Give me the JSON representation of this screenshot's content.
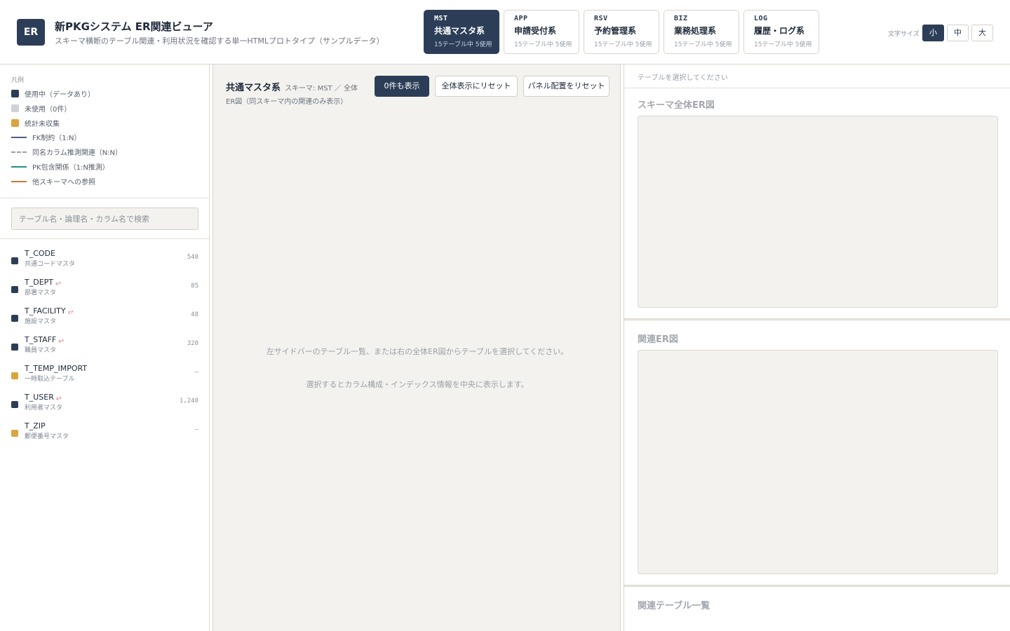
{
  "header": {
    "logo": "ER",
    "title": "新PKGシステム ER関連ビューア",
    "subtitle": "スキーマ横断のテーブル関連・利用状況を確認する単一HTMLプロトタイプ（サンプルデータ）",
    "tabs": [
      {
        "code": "MST",
        "name": "共通マスタ系",
        "count": "15テーブル中 5使用",
        "active": true
      },
      {
        "code": "APP",
        "name": "申請受付系",
        "count": "15テーブル中 5使用",
        "active": false
      },
      {
        "code": "RSV",
        "name": "予約管理系",
        "count": "15テーブル中 5使用",
        "active": false
      },
      {
        "code": "BIZ",
        "name": "業務処理系",
        "count": "15テーブル中 5使用",
        "active": false
      },
      {
        "code": "LOG",
        "name": "履歴・ログ系",
        "count": "15テーブル中 5使用",
        "active": false
      }
    ],
    "font_size_label": "文字サイズ",
    "font_sizes": [
      "小",
      "中",
      "大"
    ]
  },
  "legend": {
    "title": "凡例",
    "items": [
      {
        "label": "使用中（データあり）",
        "kind": "swatch",
        "color": "#2c3e57"
      },
      {
        "label": "未使用（0件）",
        "kind": "swatch",
        "color": "#cfd2d6"
      },
      {
        "label": "統計未収集",
        "kind": "swatch",
        "color": "#dba440"
      },
      {
        "label": "FK制約（1:N）",
        "kind": "line",
        "color": "#4a6280",
        "style": "solid"
      },
      {
        "label": "同名カラム推測関連（N:N）",
        "kind": "line",
        "color": "#9aa0a8",
        "style": "dashed"
      },
      {
        "label": "PK包含関係（1:N推測）",
        "kind": "line",
        "color": "#2a8c88",
        "style": "solid"
      },
      {
        "label": "他スキーマへの参照",
        "kind": "line",
        "color": "#c27a3a",
        "style": "solid"
      }
    ]
  },
  "search": {
    "placeholder": "テーブル名・論理名・カラム名で検索",
    "value": ""
  },
  "tables": [
    {
      "name": "T_CODE",
      "logical": "共通コードマスタ",
      "count": "540",
      "status_color": "#2c3e57",
      "rel": ""
    },
    {
      "name": "T_DEPT",
      "logical": "部署マスタ",
      "count": "85",
      "status_color": "#2c3e57",
      "rel": "⥂"
    },
    {
      "name": "T_FACILITY",
      "logical": "施設マスタ",
      "count": "48",
      "status_color": "#2c3e57",
      "rel": "⥂"
    },
    {
      "name": "T_STAFF",
      "logical": "職員マスタ",
      "count": "320",
      "status_color": "#2c3e57",
      "rel": "⥂"
    },
    {
      "name": "T_TEMP_IMPORT",
      "logical": "一時取込テーブル",
      "count": "—",
      "status_color": "#dba440",
      "rel": ""
    },
    {
      "name": "T_USER",
      "logical": "利用者マスタ",
      "count": "1,240",
      "status_color": "#2c3e57",
      "rel": "⥂"
    },
    {
      "name": "T_ZIP",
      "logical": "郵便番号マスタ",
      "count": "—",
      "status_color": "#dba440",
      "rel": ""
    }
  ],
  "center": {
    "title": "共通マスタ系",
    "schema_label": "スキーマ: MST ／ 全体",
    "subtitle": "ER図（同スキーマ内の関連のみ表示）",
    "buttons": {
      "show_zero": "0件も表示",
      "reset_view": "全体表示にリセット",
      "reset_panels": "パネル配置をリセット"
    },
    "empty_line1": "左サイドバーのテーブル一覧、または右の全体ER図からテーブルを選択してください。",
    "empty_line2": "選択するとカラム構成・インデックス情報を中央に表示します。"
  },
  "right": {
    "hint": "テーブルを選択してください",
    "schema_er_title": "スキーマ全体ER図",
    "related_er_title": "関連ER図",
    "related_tables_title": "関連テーブル一覧"
  }
}
